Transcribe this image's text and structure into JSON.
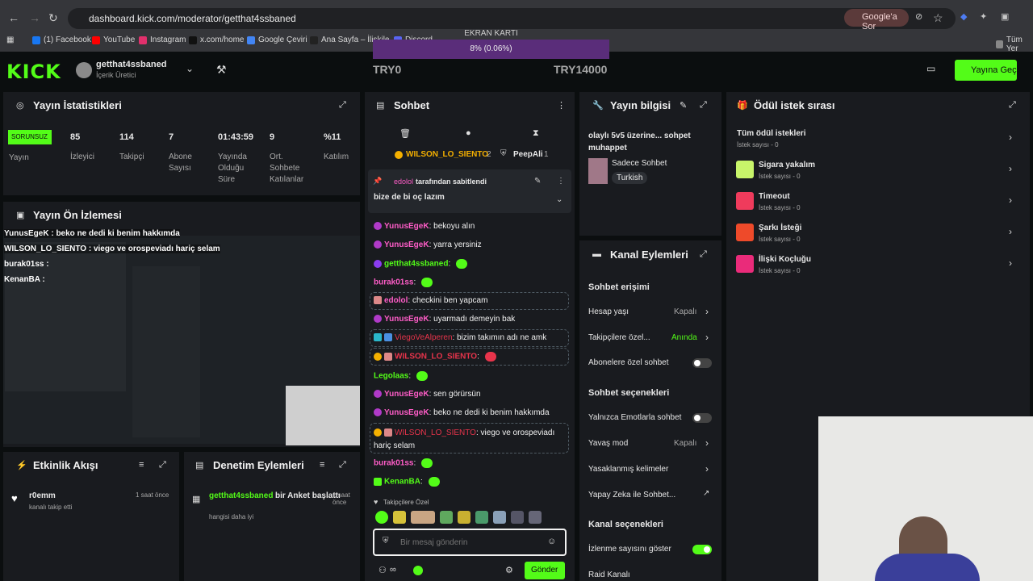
{
  "browser": {
    "url": "dashboard.kick.com/moderator/getthat4ssbaned",
    "google_ask": "Google'a Sor",
    "bookmarks": [
      "(1) Facebook",
      "YouTube",
      "Instagram",
      "x.com/home",
      "Google Çeviri",
      "Ana Sayfa – İlişkile",
      "Discord",
      "Tüm Yer"
    ],
    "bookmark_colors": [
      "#1877f2",
      "#ff0000",
      "#e1306c",
      "#111111",
      "#4285f4",
      "#222222",
      "#5865f2",
      "#888888"
    ]
  },
  "overlay": {
    "ekran_label": "EKRAN KARTI",
    "ekran_value": "8% (0.06%)",
    "try_left": "TRY0",
    "try_right": "TRY14000"
  },
  "header": {
    "logo": "KICK",
    "channel": "getthat4ssbaned",
    "role": "İçerik Üretici",
    "go_live": "Yayına Geç"
  },
  "stats": {
    "title": "Yayın İstatistikleri",
    "status": "SORUNSUZ",
    "status_label": "Yayın",
    "items": [
      {
        "value": "85",
        "label": "İzleyici"
      },
      {
        "value": "114",
        "label": "Takipçi"
      },
      {
        "value": "7",
        "label": "Abone Sayısı"
      },
      {
        "value": "01:43:59",
        "label": "Yayında Olduğu Süre"
      },
      {
        "value": "9",
        "label": "Ort. Sohbete Katılanlar"
      },
      {
        "value": "%11",
        "label": "Katılım"
      }
    ]
  },
  "preview": {
    "title": "Yayın Ön İzlemesi",
    "lines": [
      "YunusEgeK : beko ne dedi ki benim hakkımda",
      "WILSON_LO_SIENTO : viego ve orospeviadı hariç selam",
      "burak01ss :",
      "KenanBA :"
    ]
  },
  "activity": {
    "title": "Etkinlik Akışı",
    "user": "r0emm",
    "desc": "kanalı takip etti",
    "time": "1 saat önce"
  },
  "moderation": {
    "title": "Denetim Eylemleri",
    "user": "getthat4ssbaned",
    "action": "bir Anket başlattı",
    "desc": "hangisi daha iyi",
    "time": "1 saat önce"
  },
  "chat": {
    "title": "Sohbet",
    "top_users": [
      {
        "name": "WILSON_LO_SIENTO",
        "count": "2"
      },
      {
        "name": "PeepAli",
        "count": "1"
      }
    ],
    "pinned_by": "edolol",
    "pinned_suffix": "tarafından sabitlendi",
    "pinned_msg": "bize de bi oç lazım",
    "messages": [
      {
        "user": "YunusEgeK",
        "text": "bekoyu alın"
      },
      {
        "user": "YunusEgeK",
        "text": "yarra yersiniz"
      },
      {
        "user": "getthat4ssbaned",
        "text": ""
      },
      {
        "user": "burak01ss",
        "text": ""
      },
      {
        "user": "edolol",
        "text": "checkini ben yapcam"
      },
      {
        "user": "YunusEgeK",
        "text": "uyarmadı demeyin bak"
      },
      {
        "user": "ViegoVeAlperen",
        "text": "bizim takımın adı ne amk"
      },
      {
        "user": "WILSON_LO_SIENTO",
        "text": ""
      },
      {
        "user": "Legolaas",
        "text": ""
      },
      {
        "user": "YunusEgeK",
        "text": "sen görürsün"
      },
      {
        "user": "YunusEgeK",
        "text": "beko ne dedi ki benim hakkımda"
      },
      {
        "user": "WILSON_LO_SIENTO",
        "text": "viego ve orospeviadı hariç selam"
      },
      {
        "user": "burak01ss",
        "text": ""
      },
      {
        "user": "KenanBA",
        "text": ""
      }
    ],
    "followers_only": "Takipçilere Özel",
    "placeholder": "Bir mesaj gönderin",
    "send": "Gönder"
  },
  "stream_info": {
    "title": "Yayın bilgisi",
    "stream_title": "olaylı 5v5 üzerine... sohpet muhappet",
    "category": "Sadece Sohbet",
    "language": "Turkish"
  },
  "channel_actions": {
    "title": "Kanal Eylemleri",
    "chat_access": "Sohbet erişimi",
    "account_age": "Hesap yaşı",
    "account_age_val": "Kapalı",
    "followers_only": "Takipçilere özel...",
    "followers_only_val": "Anında",
    "subs_only": "Abonelere özel sohbet",
    "chat_options": "Sohbet seçenekleri",
    "emotes_only": "Yalnızca Emotlarla sohbet",
    "slow_mode": "Yavaş mod",
    "slow_mode_val": "Kapalı",
    "banned_words": "Yasaklanmış kelimeler",
    "ai_chat": "Yapay Zeka ile Sohbet...",
    "channel_options": "Kanal seçenekleri",
    "show_viewers": "İzlenme sayısını göster",
    "raid": "Raid Kanalı"
  },
  "rewards": {
    "title": "Ödül istek sırası",
    "items": [
      {
        "name": "Tüm ödül istekleri",
        "count": "İstek sayısı - 0",
        "color": ""
      },
      {
        "name": "Sigara yakalım",
        "count": "İstek sayısı - 0",
        "color": "#c8f56a"
      },
      {
        "name": "Timeout",
        "count": "İstek sayısı - 0",
        "color": "#ef3b5c"
      },
      {
        "name": "Şarkı İsteği",
        "count": "İstek sayısı - 0",
        "color": "#ee4a2a"
      },
      {
        "name": "İlişki Koçluğu",
        "count": "İstek sayısı - 0",
        "color": "#ea2b7a"
      }
    ]
  }
}
